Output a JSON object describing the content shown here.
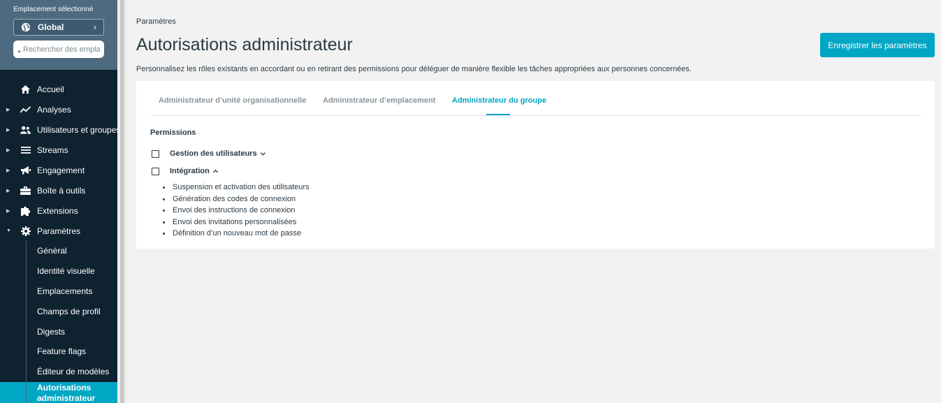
{
  "sidebar": {
    "location_label": "Emplacement sélectionné",
    "location_value": "Global",
    "search_placeholder": "Rechercher des emplacements",
    "nav": [
      {
        "label": "Accueil",
        "icon": "home-icon",
        "has_caret": false
      },
      {
        "label": "Analyses",
        "icon": "chart-line-icon",
        "has_caret": true
      },
      {
        "label": "Utilisateurs et groupes",
        "icon": "users-icon",
        "has_caret": true
      },
      {
        "label": "Streams",
        "icon": "list-icon",
        "has_caret": true
      },
      {
        "label": "Engagement",
        "icon": "megaphone-icon",
        "has_caret": true
      },
      {
        "label": "Boîte à outils",
        "icon": "toolbox-icon",
        "has_caret": true
      },
      {
        "label": "Extensions",
        "icon": "puzzle-icon",
        "has_caret": true
      },
      {
        "label": "Paramètres",
        "icon": "gear-icon",
        "has_caret": true,
        "expanded": true
      }
    ],
    "sub_items": [
      "Général",
      "Identité visuelle",
      "Emplacements",
      "Champs de profil",
      "Digests",
      "Feature flags",
      "Éditeur de modèles"
    ],
    "active_sub_line1": "Autorisations",
    "active_sub_line2": "administrateur"
  },
  "main": {
    "breadcrumb": "Paramètres",
    "title": "Autorisations administrateur",
    "save_label": "Enregistrer les paramètres",
    "description": "Personnalisez les rôles existants en accordant ou en retirant des permissions pour déléguer de manière flexible les tâches appropriées aux personnes concernées.",
    "tabs": [
      {
        "label": "Administrateur d’unité organisationnelle",
        "active": false
      },
      {
        "label": "Administrateur d’emplacement",
        "active": false
      },
      {
        "label": "Administrateur du groupe",
        "active": true
      }
    ],
    "permissions_heading": "Permissions",
    "permissions": [
      {
        "label": "Gestion des utilisateurs",
        "expanded": false,
        "checked": false
      },
      {
        "label": "Intégration",
        "expanded": true,
        "checked": false,
        "items": [
          "Suspension et activation des utilisateurs",
          "Génération des codes de connexion",
          "Envoi des instructions de connexion",
          "Envoi des invitations personnalisées",
          "Définition d’un nouveau mot de passe"
        ]
      }
    ]
  },
  "colors": {
    "accent": "#00a7c4",
    "sidebar_bg": "#0f2230",
    "sidebar_top_bg": "#4d6a80"
  }
}
